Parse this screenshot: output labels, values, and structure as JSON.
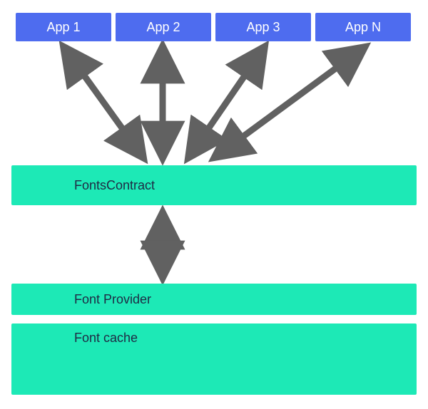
{
  "apps": {
    "a1": "App 1",
    "a2": "App 2",
    "a3": "App 3",
    "an": "App N"
  },
  "layers": {
    "fonts_contract": "FontsContract",
    "font_provider": "Font Provider",
    "font_cache": "Font cache"
  },
  "colors": {
    "app_bg": "#4e6cef",
    "layer_bg": "#1de9b6",
    "arrow": "#616161"
  }
}
